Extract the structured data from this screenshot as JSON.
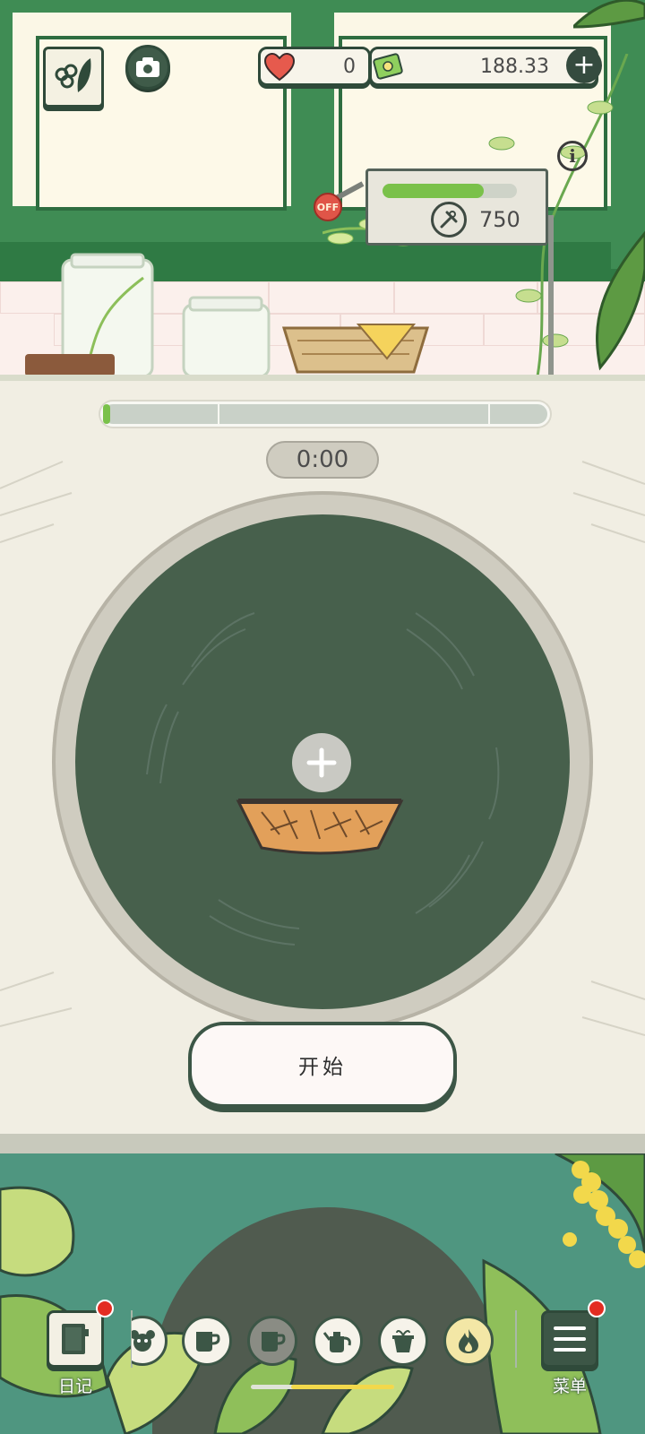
{
  "hud": {
    "hearts": "0",
    "money": "188.33",
    "plus": "+"
  },
  "machine": {
    "switch_label": "OFF",
    "progress": 0.75,
    "parts": "750"
  },
  "stage": {
    "progress": 0.01,
    "timer": "0:00",
    "start_label": "开始"
  },
  "bottom_nav": {
    "diary_label": "日记",
    "menu_label": "菜单",
    "tools": [
      "bear-icon",
      "cup-icon",
      "mug-icon",
      "kettle-icon",
      "pot-icon",
      "fire-icon"
    ]
  },
  "colors": {
    "window_green": "#3f8c54",
    "disc_green": "#47604c",
    "bottom_teal": "#4f9680",
    "accent_red": "#e32d22"
  }
}
